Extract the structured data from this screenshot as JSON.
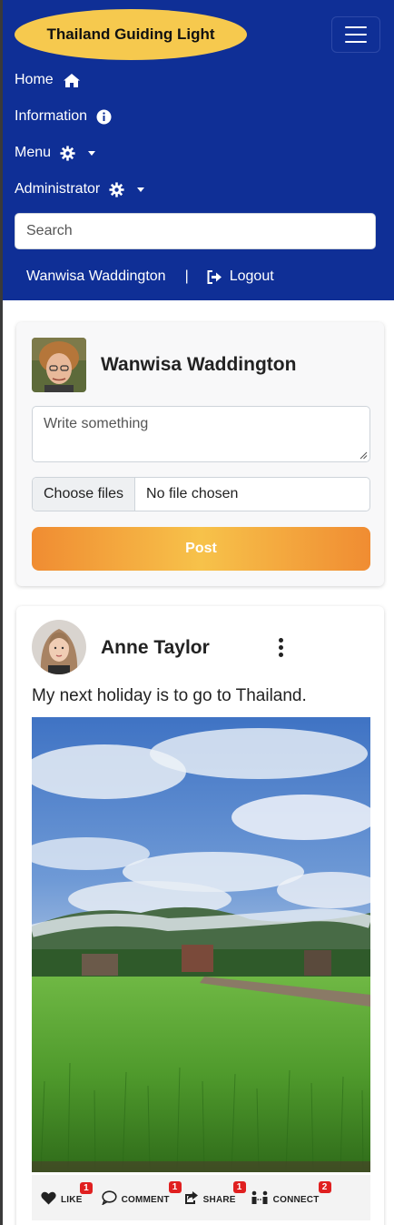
{
  "brand": {
    "title": "Thailand Guiding Light"
  },
  "nav": {
    "items": [
      {
        "label": "Home",
        "icon": "home-icon"
      },
      {
        "label": "Information",
        "icon": "info-icon"
      },
      {
        "label": "Menu",
        "icon": "gear-icon",
        "dropdown": true
      },
      {
        "label": "Administrator",
        "icon": "gear-icon",
        "dropdown": true
      }
    ],
    "search_placeholder": "Search",
    "user_name": "Wanwisa Waddington",
    "separator": "|",
    "logout_label": "Logout"
  },
  "composer": {
    "user_name": "Wanwisa Waddington",
    "placeholder": "Write something",
    "file_button": "Choose files",
    "file_status": "No file chosen",
    "post_button": "Post"
  },
  "post": {
    "author": "Anne Taylor",
    "text": "My next holiday is to go to Thailand.",
    "actions": [
      {
        "label": "LIKE",
        "icon": "heart-icon",
        "count": "1"
      },
      {
        "label": "COMMENT",
        "icon": "comment-icon",
        "count": "1"
      },
      {
        "label": "SHARE",
        "icon": "share-icon",
        "count": "1"
      },
      {
        "label": "CONNECT",
        "icon": "connect-icon",
        "count": "2"
      }
    ]
  },
  "colors": {
    "navbar": "#0f2f96",
    "brand_pill": "#f6c94e",
    "post_button_gradient": [
      "#f08c32",
      "#f7c24a"
    ],
    "badge": "#e02020"
  }
}
